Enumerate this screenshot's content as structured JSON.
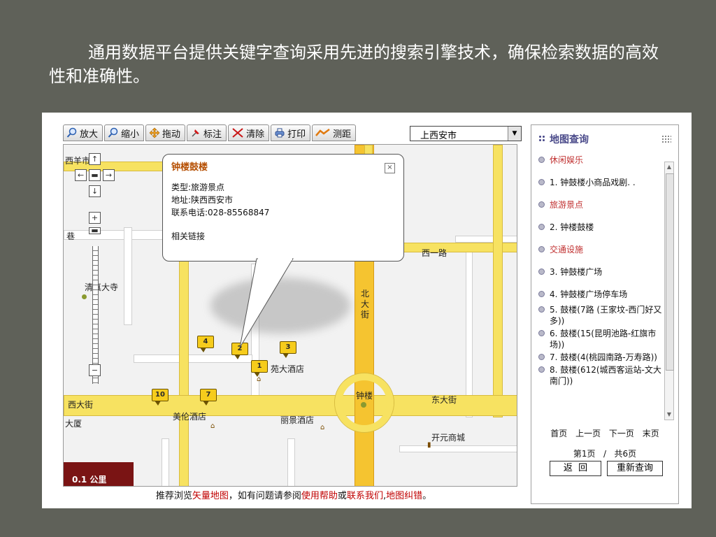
{
  "heading": "通用数据平台提供关键字查询采用先进的搜索引擎技术，确保检索数据的高效性和准确性。",
  "toolbar": {
    "zoom_in": "放大",
    "zoom_out": "缩小",
    "pan": "拖动",
    "mark": "标注",
    "clear": "清除",
    "print": "打印",
    "measure": "测距",
    "city": "上西安市"
  },
  "map": {
    "labels": {
      "xiyang": "西羊市",
      "xiang": "巷",
      "qingzhen": "清真大寺",
      "xiyilu": "西一路",
      "beidajie": "北大街",
      "xidajie": "西大街",
      "dongdajie": "东大街",
      "zhonglou": "钟楼",
      "xia": "大厦",
      "meilun": "美伦酒店",
      "lijing": "丽景酒店",
      "kaiyuan": "开元商城",
      "yuanhotel": "苑大酒店"
    },
    "markers": [
      "1",
      "2",
      "3",
      "4",
      "7",
      "10"
    ],
    "scale": "0.1 公里"
  },
  "popup": {
    "title": "钟楼鼓楼",
    "type_line": "类型:旅游景点",
    "address_line": "地址:陕西西安市",
    "phone_line": "联系电话:028-85568847",
    "link": "相关链接"
  },
  "bottom": {
    "prefix": "推荐浏览",
    "vector_map": "矢量地图",
    "middle": "，如有问题请参阅",
    "help": "使用帮助",
    "or": "或",
    "contact": "联系我们",
    "sep": ",",
    "correction": "地图纠错",
    "end": "。"
  },
  "panel": {
    "title": "地图查询",
    "items": [
      {
        "text": "休闲娱乐",
        "category": true
      },
      {
        "text": "1. 钟鼓楼小商品戏剧. .",
        "category": false
      },
      {
        "text": "旅游景点",
        "category": true
      },
      {
        "text": "2. 钟楼鼓楼",
        "category": false
      },
      {
        "text": "交通设施",
        "category": true
      },
      {
        "text": "3. 钟鼓楼广场",
        "category": false
      },
      {
        "text": "4. 钟鼓楼广场停车场",
        "category": false
      },
      {
        "text": "5. 鼓楼(7路 (王家坟-西门好又多))",
        "category": false
      },
      {
        "text": "6. 鼓楼(15(昆明池路-红旗市场))",
        "category": false
      },
      {
        "text": "7. 鼓楼(4(桃园南路-万寿路))",
        "category": false
      },
      {
        "text": "8. 鼓楼(612(城西客运站-文大南门))",
        "category": false
      }
    ],
    "pager": {
      "first": "首页",
      "prev": "上一页",
      "next": "下一页",
      "last": "末页",
      "current": "第1页",
      "slash": "/",
      "total": "共6页"
    },
    "back": "返  回",
    "requery": "重新查询"
  }
}
